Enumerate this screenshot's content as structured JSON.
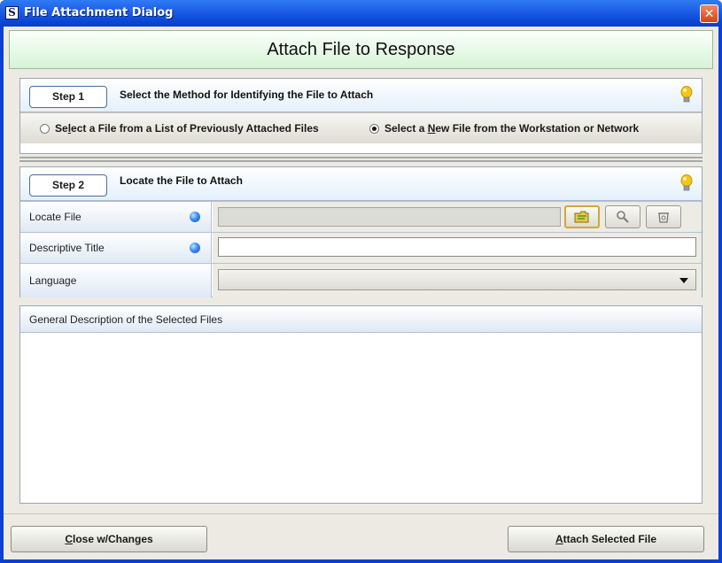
{
  "window": {
    "logo": "S",
    "title": "File Attachment Dialog",
    "close_icon": "close-icon"
  },
  "header": {
    "title": "Attach File to Response"
  },
  "step1": {
    "button_label": "Step 1",
    "title": "Select the Method for Identifying the File to Attach",
    "hint_icon": "lightbulb-icon",
    "options": [
      {
        "label_pre": "Se",
        "mnemonic": "l",
        "label_post": "ect a File from a List of Previously Attached Files",
        "selected": false
      },
      {
        "label_pre": "Select a ",
        "mnemonic": "N",
        "label_post": "ew File from the Workstation or Network",
        "selected": true
      }
    ]
  },
  "step2": {
    "button_label": "Step 2",
    "title": "Locate the File to Attach",
    "hint_icon": "lightbulb-icon",
    "fields": {
      "locate_file": {
        "label": "Locate File",
        "value": "",
        "required": true
      },
      "descriptive_title": {
        "label": "Descriptive Title",
        "value": "",
        "required": true
      },
      "language": {
        "label": "Language",
        "value": ""
      }
    },
    "locate_buttons": [
      "browse-folder-icon",
      "search-icon",
      "clear-icon"
    ]
  },
  "description": {
    "header": "General Description of the Selected Files",
    "value": ""
  },
  "footer": {
    "close": {
      "mnemonic": "C",
      "rest": "lose w/Changes"
    },
    "attach": {
      "mnemonic": "A",
      "rest": "ttach Selected File"
    }
  },
  "colors": {
    "title_bar": "#1e5fe6",
    "header_bg": "#d6f3d6",
    "required_dot": "#3d8df0",
    "client_bg": "#eceae3"
  }
}
